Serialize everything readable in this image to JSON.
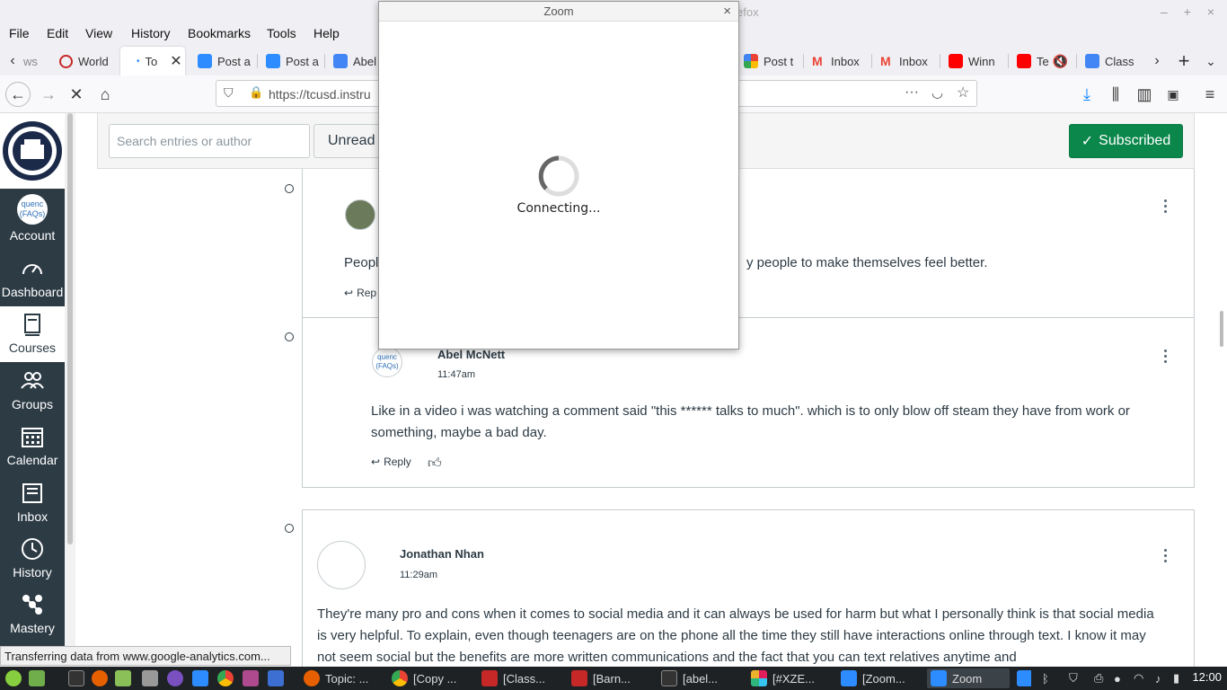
{
  "browser": {
    "title_fragment": "efox",
    "menu": [
      "File",
      "Edit",
      "View",
      "History",
      "Bookmarks",
      "Tools",
      "Help"
    ],
    "tabs": [
      {
        "label": "ws",
        "color": "#ffffff"
      },
      {
        "label": "World",
        "color": "#ffffff"
      },
      {
        "label": "To",
        "color": "#ffffff",
        "active": true
      },
      {
        "label": "Post a",
        "color": "#2d8cff"
      },
      {
        "label": "Post a",
        "color": "#2d8cff"
      },
      {
        "label": "Abel",
        "color": "#4285f4"
      },
      {
        "label": "Post t",
        "color": "#fbbc04"
      },
      {
        "label": "Inbox",
        "color": "#ea4335"
      },
      {
        "label": "Inbox",
        "color": "#ea4335"
      },
      {
        "label": "Winn",
        "color": "#ff0000"
      },
      {
        "label": "Te",
        "color": "#ff0000"
      },
      {
        "label": "Class",
        "color": "#4285f4"
      }
    ],
    "url": "https://tcusd.instru",
    "status": "Transferring data from www.google-analytics.com..."
  },
  "globalnav": {
    "items": [
      {
        "label": "Account",
        "icon": "account-avatar-icon"
      },
      {
        "label": "Dashboard",
        "icon": "dashboard-icon"
      },
      {
        "label": "Courses",
        "icon": "courses-icon"
      },
      {
        "label": "Groups",
        "icon": "groups-icon"
      },
      {
        "label": "Calendar",
        "icon": "calendar-icon"
      },
      {
        "label": "Inbox",
        "icon": "inbox-icon"
      },
      {
        "label": "History",
        "icon": "history-icon"
      },
      {
        "label": "Mastery",
        "icon": "mastery-icon"
      }
    ],
    "account_avatar_text": "(FAQs)",
    "account_avatar_top": "quenc"
  },
  "discussion": {
    "search_placeholder": "Search entries or author",
    "filter_label": "Unread",
    "subscribed_label": "Subscribed",
    "entries": [
      {
        "author": "",
        "time": "",
        "message_start": "Peopl",
        "message_end": "y people to make themselves feel better.",
        "reply": "Rep"
      },
      {
        "author": "Abel McNett",
        "time": "11:47am",
        "avatar_top": "quenc",
        "avatar_text": "(FAQs)",
        "message": "Like in a video i was watching a comment said \"this ****** talks to much\". which is to only blow off steam they have from work or something, maybe a bad day.",
        "reply": "Reply"
      },
      {
        "author": "Jonathan Nhan",
        "time": "11:29am",
        "message": "They're many pro and cons when it comes to social media and it can always be used for harm but what I personally think is that social media is very helpful. To explain, even though teenagers are on the phone all the time they still have interactions online through text. I know it may not seem social but the benefits are more written communications and the fact that you can text relatives anytime and"
      }
    ]
  },
  "zoom_dialog": {
    "title": "Zoom",
    "status": "Connecting..."
  },
  "taskbar": {
    "windows": [
      {
        "label": "Topic: ...",
        "color": "#e66000"
      },
      {
        "label": "[Copy ...",
        "color": "#4285f4"
      },
      {
        "label": "[Class...",
        "color": "#c62828"
      },
      {
        "label": "[Barn...",
        "color": "#c62828"
      },
      {
        "label": "[abel...",
        "color": "#333333"
      },
      {
        "label": "[#XZE...",
        "color": "#e01e5a"
      },
      {
        "label": "[Zoom...",
        "color": "#2d8cff"
      },
      {
        "label": "Zoom",
        "color": "#2d8cff",
        "active": true
      }
    ],
    "clock": "12:00"
  }
}
